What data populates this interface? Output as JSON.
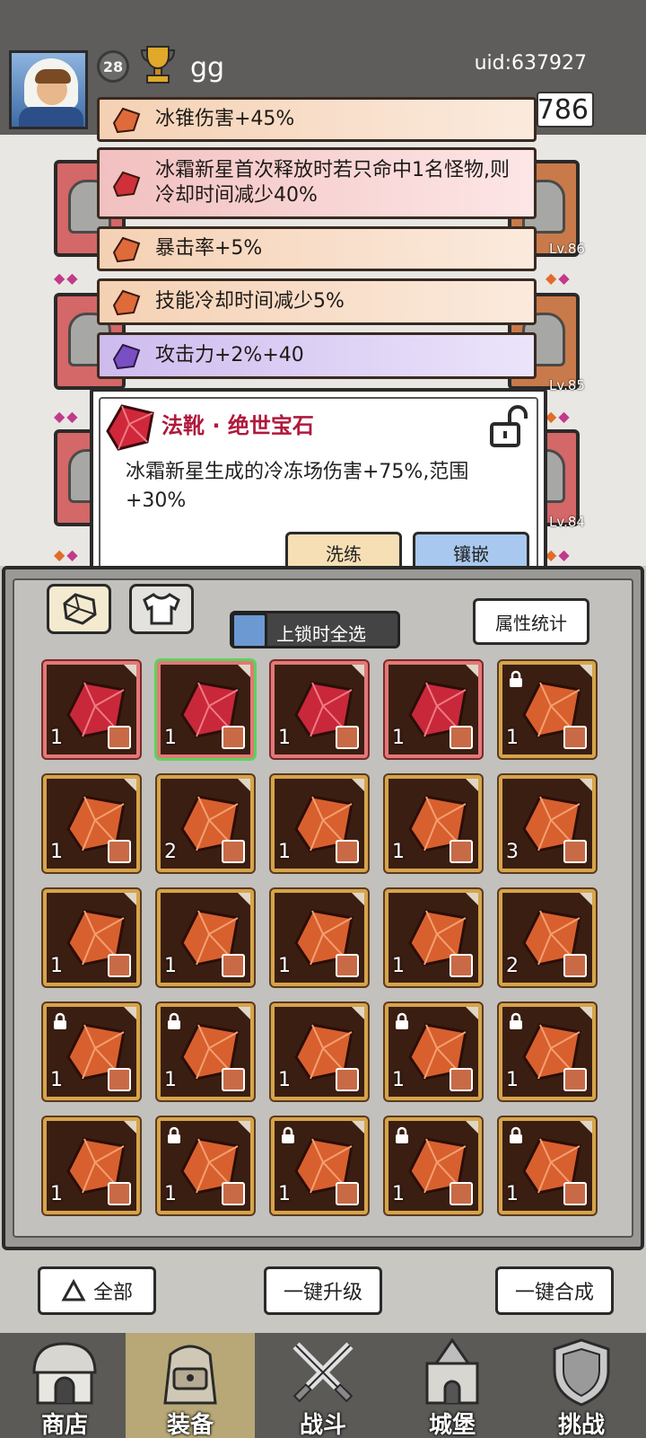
{
  "header": {
    "level": "28",
    "player_name": "gg",
    "uid": "uid:637927",
    "currency": "786"
  },
  "equipment": {
    "levels": [
      "Lv.86",
      "Lv.85",
      "Lv.84"
    ]
  },
  "affixes": [
    {
      "text": "冰锥伤害+45%",
      "color": "orange"
    },
    {
      "text": "冰霜新星首次释放时若只命中1名怪物,则冷却时间减少40%",
      "color": "red"
    },
    {
      "text": "暴击率+5%",
      "color": "orange"
    },
    {
      "text": "技能冷却时间减少5%",
      "color": "orange"
    },
    {
      "text": "攻击力+2%+40",
      "color": "purple"
    }
  ],
  "gem_popup": {
    "title": "法靴 · 绝世宝石",
    "description": "冰霜新星生成的冷冻场伤害+75%,范围+30%",
    "reforge_label": "洗练",
    "embed_label": "镶嵌"
  },
  "inventory": {
    "select_all_label": "上锁时全选",
    "stats_label": "属性统计",
    "cells": [
      {
        "count": "1",
        "red": true,
        "lock": false
      },
      {
        "count": "1",
        "red": true,
        "lock": false,
        "selected": true
      },
      {
        "count": "1",
        "red": true,
        "lock": false
      },
      {
        "count": "1",
        "red": true,
        "lock": false
      },
      {
        "count": "1",
        "red": false,
        "lock": true
      },
      {
        "count": "1",
        "red": false,
        "lock": false
      },
      {
        "count": "2",
        "red": false,
        "lock": false
      },
      {
        "count": "1",
        "red": false,
        "lock": false
      },
      {
        "count": "1",
        "red": false,
        "lock": false
      },
      {
        "count": "3",
        "red": false,
        "lock": false
      },
      {
        "count": "1",
        "red": false,
        "lock": false
      },
      {
        "count": "1",
        "red": false,
        "lock": false
      },
      {
        "count": "1",
        "red": false,
        "lock": false
      },
      {
        "count": "1",
        "red": false,
        "lock": false
      },
      {
        "count": "2",
        "red": false,
        "lock": false
      },
      {
        "count": "1",
        "red": false,
        "lock": true
      },
      {
        "count": "1",
        "red": false,
        "lock": true
      },
      {
        "count": "1",
        "red": false,
        "lock": false
      },
      {
        "count": "1",
        "red": false,
        "lock": true
      },
      {
        "count": "1",
        "red": false,
        "lock": true
      },
      {
        "count": "1",
        "red": false,
        "lock": false
      },
      {
        "count": "1",
        "red": false,
        "lock": true
      },
      {
        "count": "1",
        "red": false,
        "lock": true
      },
      {
        "count": "1",
        "red": false,
        "lock": true
      },
      {
        "count": "1",
        "red": false,
        "lock": true
      }
    ]
  },
  "actions": {
    "all_label": "全部",
    "upgrade_label": "一键升级",
    "merge_label": "一键合成"
  },
  "nav": [
    {
      "label": "商店",
      "icon": "shop-icon"
    },
    {
      "label": "装备",
      "icon": "backpack-icon"
    },
    {
      "label": "战斗",
      "icon": "swords-icon"
    },
    {
      "label": "城堡",
      "icon": "castle-icon"
    },
    {
      "label": "挑战",
      "icon": "shield-icon"
    }
  ]
}
